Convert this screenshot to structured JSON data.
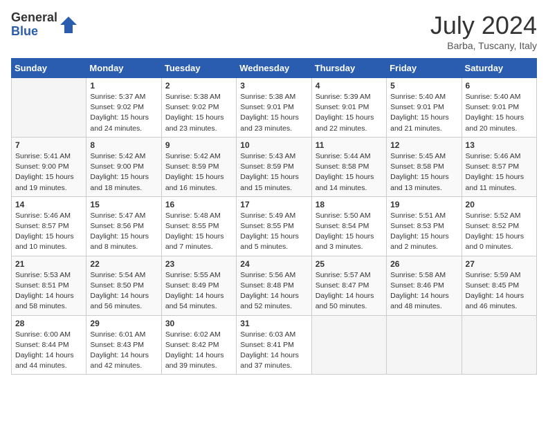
{
  "logo": {
    "general": "General",
    "blue": "Blue"
  },
  "title": {
    "month_year": "July 2024",
    "location": "Barba, Tuscany, Italy"
  },
  "weekdays": [
    "Sunday",
    "Monday",
    "Tuesday",
    "Wednesday",
    "Thursday",
    "Friday",
    "Saturday"
  ],
  "weeks": [
    [
      {
        "day": "",
        "info": ""
      },
      {
        "day": "1",
        "info": "Sunrise: 5:37 AM\nSunset: 9:02 PM\nDaylight: 15 hours\nand 24 minutes."
      },
      {
        "day": "2",
        "info": "Sunrise: 5:38 AM\nSunset: 9:02 PM\nDaylight: 15 hours\nand 23 minutes."
      },
      {
        "day": "3",
        "info": "Sunrise: 5:38 AM\nSunset: 9:01 PM\nDaylight: 15 hours\nand 23 minutes."
      },
      {
        "day": "4",
        "info": "Sunrise: 5:39 AM\nSunset: 9:01 PM\nDaylight: 15 hours\nand 22 minutes."
      },
      {
        "day": "5",
        "info": "Sunrise: 5:40 AM\nSunset: 9:01 PM\nDaylight: 15 hours\nand 21 minutes."
      },
      {
        "day": "6",
        "info": "Sunrise: 5:40 AM\nSunset: 9:01 PM\nDaylight: 15 hours\nand 20 minutes."
      }
    ],
    [
      {
        "day": "7",
        "info": "Sunrise: 5:41 AM\nSunset: 9:00 PM\nDaylight: 15 hours\nand 19 minutes."
      },
      {
        "day": "8",
        "info": "Sunrise: 5:42 AM\nSunset: 9:00 PM\nDaylight: 15 hours\nand 18 minutes."
      },
      {
        "day": "9",
        "info": "Sunrise: 5:42 AM\nSunset: 8:59 PM\nDaylight: 15 hours\nand 16 minutes."
      },
      {
        "day": "10",
        "info": "Sunrise: 5:43 AM\nSunset: 8:59 PM\nDaylight: 15 hours\nand 15 minutes."
      },
      {
        "day": "11",
        "info": "Sunrise: 5:44 AM\nSunset: 8:58 PM\nDaylight: 15 hours\nand 14 minutes."
      },
      {
        "day": "12",
        "info": "Sunrise: 5:45 AM\nSunset: 8:58 PM\nDaylight: 15 hours\nand 13 minutes."
      },
      {
        "day": "13",
        "info": "Sunrise: 5:46 AM\nSunset: 8:57 PM\nDaylight: 15 hours\nand 11 minutes."
      }
    ],
    [
      {
        "day": "14",
        "info": "Sunrise: 5:46 AM\nSunset: 8:57 PM\nDaylight: 15 hours\nand 10 minutes."
      },
      {
        "day": "15",
        "info": "Sunrise: 5:47 AM\nSunset: 8:56 PM\nDaylight: 15 hours\nand 8 minutes."
      },
      {
        "day": "16",
        "info": "Sunrise: 5:48 AM\nSunset: 8:55 PM\nDaylight: 15 hours\nand 7 minutes."
      },
      {
        "day": "17",
        "info": "Sunrise: 5:49 AM\nSunset: 8:55 PM\nDaylight: 15 hours\nand 5 minutes."
      },
      {
        "day": "18",
        "info": "Sunrise: 5:50 AM\nSunset: 8:54 PM\nDaylight: 15 hours\nand 3 minutes."
      },
      {
        "day": "19",
        "info": "Sunrise: 5:51 AM\nSunset: 8:53 PM\nDaylight: 15 hours\nand 2 minutes."
      },
      {
        "day": "20",
        "info": "Sunrise: 5:52 AM\nSunset: 8:52 PM\nDaylight: 15 hours\nand 0 minutes."
      }
    ],
    [
      {
        "day": "21",
        "info": "Sunrise: 5:53 AM\nSunset: 8:51 PM\nDaylight: 14 hours\nand 58 minutes."
      },
      {
        "day": "22",
        "info": "Sunrise: 5:54 AM\nSunset: 8:50 PM\nDaylight: 14 hours\nand 56 minutes."
      },
      {
        "day": "23",
        "info": "Sunrise: 5:55 AM\nSunset: 8:49 PM\nDaylight: 14 hours\nand 54 minutes."
      },
      {
        "day": "24",
        "info": "Sunrise: 5:56 AM\nSunset: 8:48 PM\nDaylight: 14 hours\nand 52 minutes."
      },
      {
        "day": "25",
        "info": "Sunrise: 5:57 AM\nSunset: 8:47 PM\nDaylight: 14 hours\nand 50 minutes."
      },
      {
        "day": "26",
        "info": "Sunrise: 5:58 AM\nSunset: 8:46 PM\nDaylight: 14 hours\nand 48 minutes."
      },
      {
        "day": "27",
        "info": "Sunrise: 5:59 AM\nSunset: 8:45 PM\nDaylight: 14 hours\nand 46 minutes."
      }
    ],
    [
      {
        "day": "28",
        "info": "Sunrise: 6:00 AM\nSunset: 8:44 PM\nDaylight: 14 hours\nand 44 minutes."
      },
      {
        "day": "29",
        "info": "Sunrise: 6:01 AM\nSunset: 8:43 PM\nDaylight: 14 hours\nand 42 minutes."
      },
      {
        "day": "30",
        "info": "Sunrise: 6:02 AM\nSunset: 8:42 PM\nDaylight: 14 hours\nand 39 minutes."
      },
      {
        "day": "31",
        "info": "Sunrise: 6:03 AM\nSunset: 8:41 PM\nDaylight: 14 hours\nand 37 minutes."
      },
      {
        "day": "",
        "info": ""
      },
      {
        "day": "",
        "info": ""
      },
      {
        "day": "",
        "info": ""
      }
    ]
  ]
}
